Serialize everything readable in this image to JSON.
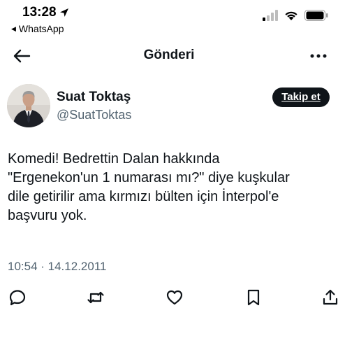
{
  "status_bar": {
    "time": "13:28",
    "back_app_label": "WhatsApp"
  },
  "header": {
    "title": "Gönderi"
  },
  "tweet": {
    "author_name": "Suat Toktaş",
    "author_handle": "@SuatToktas",
    "follow_label": "Takip et",
    "text_lines": [
      "Komedi! Bedrettin Dalan hakkında",
      "\"Ergenekon'un 1 numarası mı?\" diye kuşkular",
      "dile getirilir ama kırmızı bülten için İnterpol'e",
      "başvuru yok."
    ],
    "timestamp": "10:54 · 14.12.2011"
  },
  "icons": {
    "location": "location-arrow-icon",
    "signal": "cellular-signal-icon",
    "wifi": "wifi-icon",
    "battery": "battery-icon",
    "back": "back-arrow-icon",
    "more": "more-options-icon",
    "reply": "reply-icon",
    "retweet": "retweet-icon",
    "like": "like-icon",
    "bookmark": "bookmark-icon",
    "share": "share-icon"
  },
  "colors": {
    "text_primary": "#0f1419",
    "text_secondary": "#536471",
    "follow_button_bg": "#0f1419",
    "follow_button_text": "#ffffff"
  }
}
